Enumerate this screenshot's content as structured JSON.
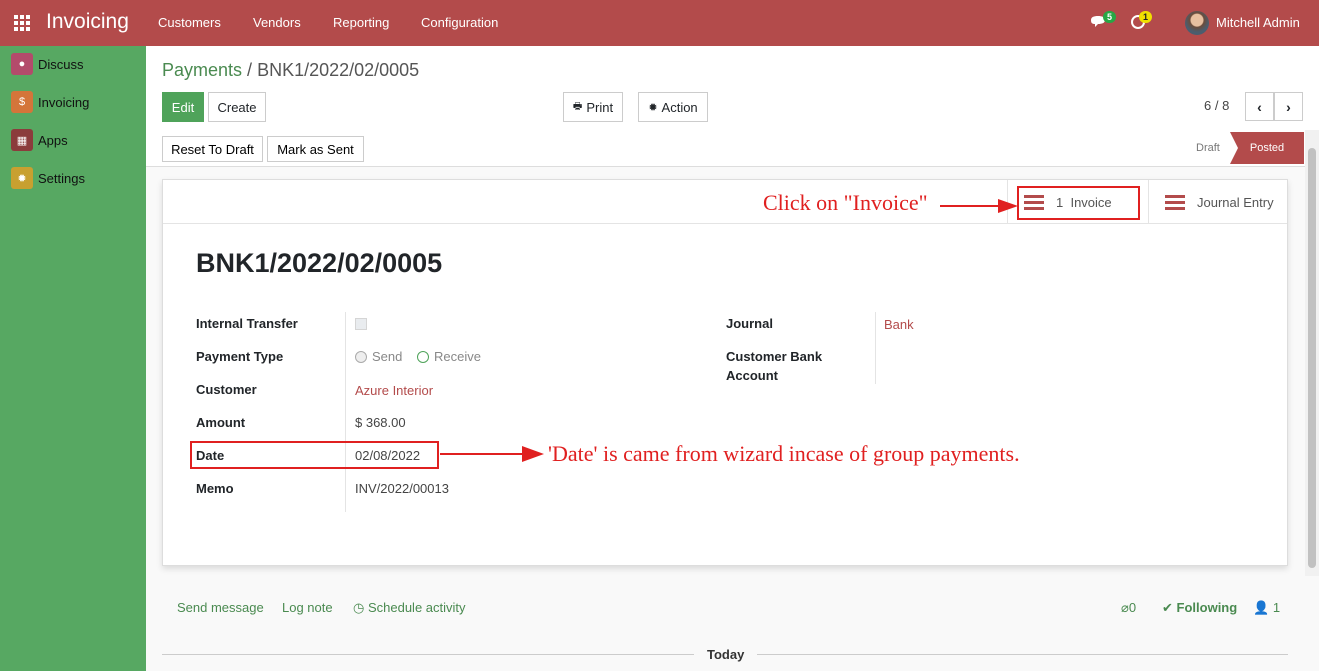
{
  "topbar": {
    "brand": "Invoicing",
    "menu": [
      "Customers",
      "Vendors",
      "Reporting",
      "Configuration"
    ],
    "messages_count": "5",
    "activities_count": "1",
    "user": "Mitchell Admin",
    "bg_color": "#b34b4b"
  },
  "sidebar": {
    "items": [
      {
        "label": "Discuss",
        "icon": "chat-bubble-icon",
        "color": "#b34b6b"
      },
      {
        "label": "Invoicing",
        "icon": "invoice-icon",
        "color": "#d4753a"
      },
      {
        "label": "Apps",
        "icon": "apps-cubes-icon",
        "color": "#8b3c3c"
      },
      {
        "label": "Settings",
        "icon": "gear-icon",
        "color": "#c8a030"
      }
    ],
    "bg_color": "#57a862"
  },
  "control": {
    "breadcrumb_parent": "Payments",
    "breadcrumb_sep": " / ",
    "breadcrumb_current": "BNK1/2022/02/0005",
    "edit": "Edit",
    "create": "Create",
    "print": "Print",
    "action": "Action",
    "pager": "6 / 8",
    "reset_to_draft": "Reset To Draft",
    "mark_as_sent": "Mark as Sent",
    "stage_draft": "Draft",
    "stage_posted": "Posted"
  },
  "sheet": {
    "stat_invoice_count": "1",
    "stat_invoice_label": "Invoice",
    "stat_journal_entry": "Journal Entry",
    "title": "BNK1/2022/02/0005",
    "fields": {
      "internal_transfer_label": "Internal Transfer",
      "payment_type_label": "Payment Type",
      "payment_type_send": "Send",
      "payment_type_receive": "Receive",
      "customer_label": "Customer",
      "customer_value": "Azure Interior",
      "amount_label": "Amount",
      "amount_value": "$ 368.00",
      "date_label": "Date",
      "date_value": "02/08/2022",
      "memo_label": "Memo",
      "memo_value": "INV/2022/00013",
      "journal_label": "Journal",
      "journal_value": "Bank",
      "customer_bank_label_1": "Customer Bank",
      "customer_bank_label_2": "Account"
    }
  },
  "annotations": {
    "invoice_note": "Click on \"Invoice\"",
    "date_note": "'Date' is came from wizard incase of group payments.",
    "color": "#e02020"
  },
  "chatter": {
    "send_message": "Send message",
    "log_note": "Log note",
    "schedule_activity": "Schedule activity",
    "attachments": "0",
    "following": "Following",
    "followers": "1",
    "today": "Today"
  }
}
